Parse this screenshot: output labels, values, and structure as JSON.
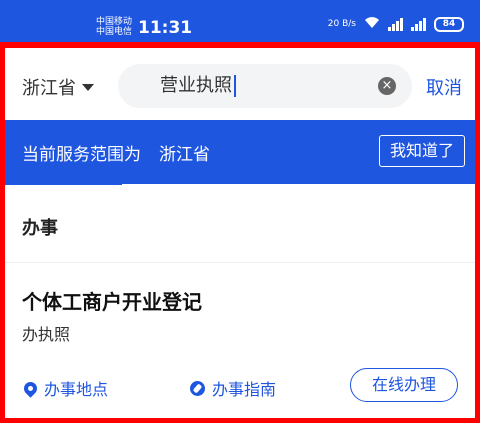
{
  "statusbar": {
    "carrier_line1": "中国移动",
    "carrier_line2": "中国电信",
    "time": "11:31",
    "net_speed": "20 B/s",
    "battery": "84"
  },
  "search": {
    "region": "浙江省",
    "query": "营业执照",
    "cancel": "取消"
  },
  "banner": {
    "scope_label": "当前服务范围为",
    "scope_region": "浙江省",
    "got_it": "我知道了"
  },
  "section": {
    "title": "办事"
  },
  "result": {
    "title": "个体工商户开业登记",
    "subtitle": "办执照",
    "actions": {
      "location": "办事地点",
      "guide": "办事指南",
      "online": "在线办理"
    }
  },
  "colors": {
    "primary": "#1f56e0",
    "highlight_frame": "#ff0000"
  }
}
